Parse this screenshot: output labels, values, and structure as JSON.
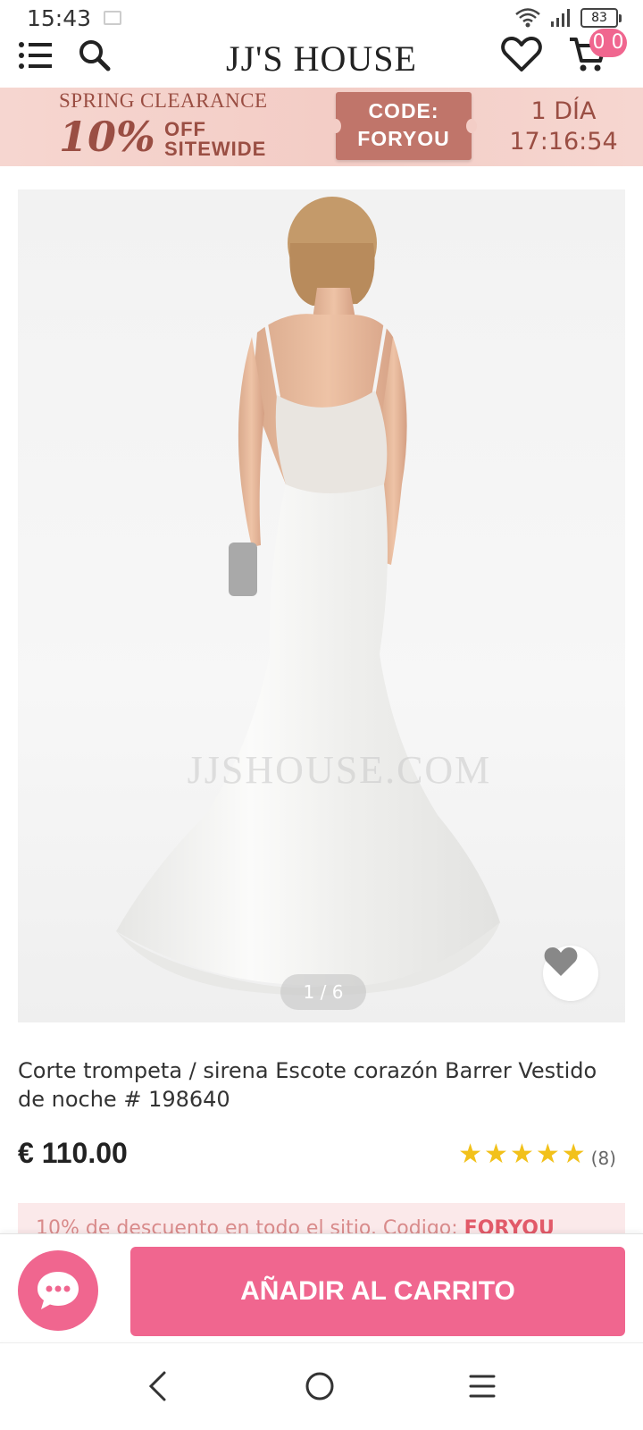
{
  "status_bar": {
    "time": "15:43",
    "battery": "83"
  },
  "header": {
    "brand": "JJ'S HOUSE",
    "cart_count": "0 0",
    "icons": [
      "menu-icon",
      "search-icon",
      "heart-icon",
      "cart-icon"
    ]
  },
  "promo": {
    "title": "SPRING CLEARANCE",
    "percent": "10%",
    "off_line1": "OFF",
    "off_line2": "SITEWIDE",
    "code_label": "CODE:",
    "code": "FORYOU",
    "timer_days": "1 DÍA",
    "timer_time": "17:16:54"
  },
  "gallery": {
    "pager": "1 / 6",
    "watermark": "JJSHOUSE.COM"
  },
  "product": {
    "title": "Corte trompeta / sirena Escote corazón Barrer Vestido de noche # 198640",
    "price": "€ 110.00",
    "rating": 5,
    "review_count": "(8)"
  },
  "discount": {
    "text": "10% de descuento en todo el sitio. Codigo: ",
    "code": "FORYOU"
  },
  "actions": {
    "add_to_cart": "AÑADIR AL CARRITO"
  },
  "colors": {
    "accent": "#f0668f",
    "promo_text": "#9a4e43",
    "star": "#f2c11a"
  }
}
